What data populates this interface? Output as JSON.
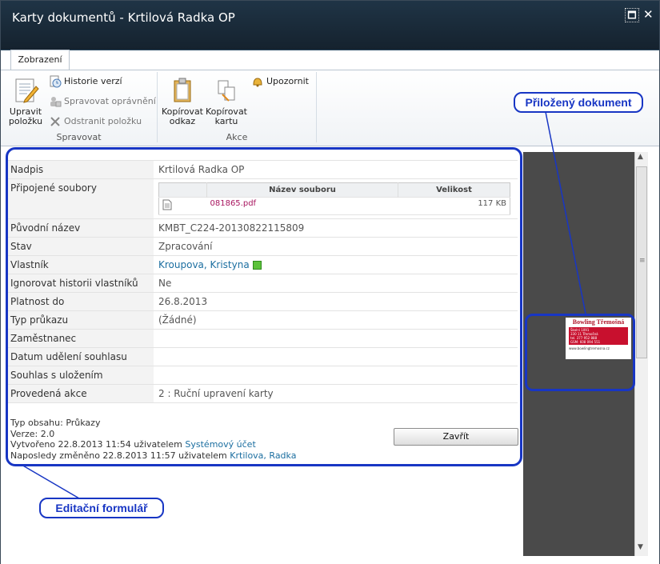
{
  "window": {
    "title": "Karty dokumentů - Krtilová Radka OP",
    "maximize_label": "🗖",
    "close_label": "✕"
  },
  "ribbon": {
    "tab": "Zobrazení",
    "groups": {
      "spravovat": {
        "label": "Spravovat",
        "edit": "Upravit položku",
        "history": "Historie verzí",
        "permissions": "Spravovat oprávnění",
        "delete": "Odstranit položku"
      },
      "akce": {
        "label": "Akce",
        "copy_link": "Kopírovat odkaz",
        "copy_card": "Kopírovat kartu",
        "alert": "Upozornit"
      }
    }
  },
  "form": {
    "fields": [
      {
        "label": "Nadpis",
        "value": "Krtilová Radka OP"
      },
      {
        "label": "Připojené soubory",
        "value": ""
      },
      {
        "label": "Původní název",
        "value": "KMBT_C224-20130822115809"
      },
      {
        "label": "Stav",
        "value": "Zpracování"
      },
      {
        "label": "Vlastník",
        "value": "Kroupova, Kristyna"
      },
      {
        "label": "Ignorovat historii vlastníků",
        "value": "Ne"
      },
      {
        "label": "Platnost do",
        "value": "26.8.2013"
      },
      {
        "label": "Typ průkazu",
        "value": "(Žádné)"
      },
      {
        "label": "Zaměstnanec",
        "value": ""
      },
      {
        "label": "Datum udělení souhlasu",
        "value": ""
      },
      {
        "label": "Souhlas s uložením",
        "value": ""
      },
      {
        "label": "Provedená akce",
        "value": "2 : Ruční upravení karty"
      }
    ],
    "attachments": {
      "header_name": "Název souboru",
      "header_size": "Velikost",
      "file_name": "081865.pdf",
      "file_size": "117 KB"
    },
    "meta": {
      "content_type": "Typ obsahu: Průkazy",
      "version": "Verze: 2.0",
      "created_prefix": "Vytvořeno 22.8.2013 11:54 uživatelem",
      "created_by": "Systémový účet",
      "modified_prefix": "Naposledy změněno 22.8.2013 11:57 uživatelem",
      "modified_by": "Krtilova, Radka"
    },
    "close_button": "Zavřít"
  },
  "preview": {
    "doc_title": "Bowling Třemošná",
    "doc_line1": "Školní 1091",
    "doc_line2": "330 11 Třemošná",
    "doc_tel": "tel. 377 952 888",
    "doc_gsm": "GSM: 608 094 551",
    "doc_web": "www.bowlingtremosna.cz"
  },
  "callouts": {
    "attached": "Přiložený dokument",
    "form": "Editační formulář"
  },
  "colors": {
    "annotation": "#1836c4",
    "titlebar": "#1f3446",
    "link": "#1b6ea0"
  }
}
